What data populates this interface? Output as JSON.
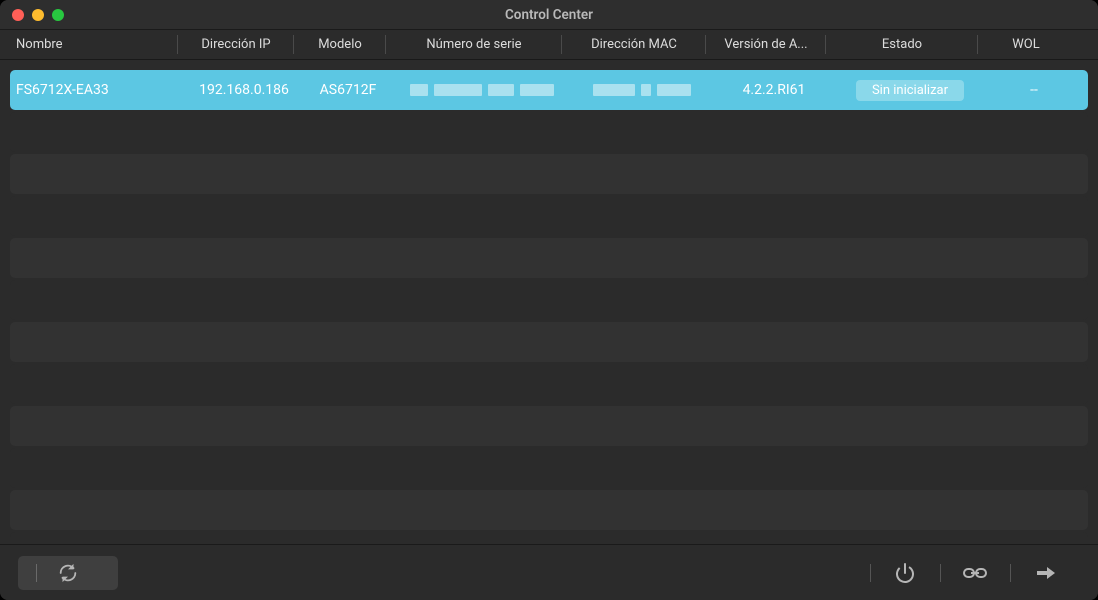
{
  "window": {
    "title": "Control Center"
  },
  "columns": {
    "name": "Nombre",
    "ip": "Dirección IP",
    "model": "Modelo",
    "serial": "Número de serie",
    "mac": "Dirección MAC",
    "version": "Versión de A...",
    "status": "Estado",
    "wol": "WOL"
  },
  "rows": [
    {
      "name": "FS6712X-EA33",
      "ip": "192.168.0.186",
      "model": "AS6712F",
      "serial": "",
      "mac": "",
      "version": "4.2.2.RI61",
      "status_label": "Sin inicializar",
      "wol": "--"
    }
  ]
}
